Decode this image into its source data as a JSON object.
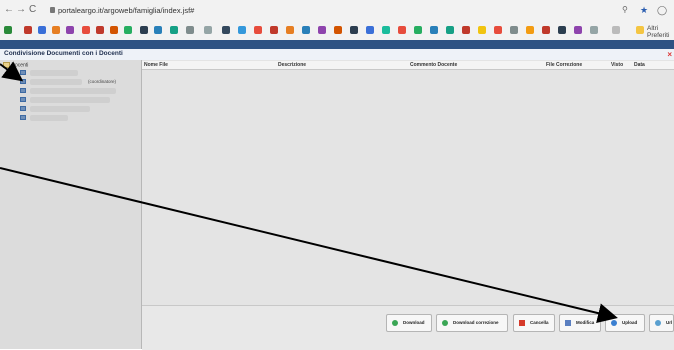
{
  "browser": {
    "url": "portaleargo.it/argoweb/famiglia/index.jsf#",
    "bookmarks_other": "Altri Preferiti"
  },
  "app": {
    "title": "Condivisione Documenti con i Docenti",
    "close_label": "×"
  },
  "tree": {
    "root_label": "Docenti",
    "coordinator_label": "(coordinatore)"
  },
  "table": {
    "columns": [
      "Nome File",
      "Descrizione",
      "Commento Docente",
      "File Correzione",
      "Visto",
      "Data"
    ]
  },
  "buttons": {
    "download": "Download",
    "download_correction": "Download correzione",
    "delete": "Cancella",
    "modify": "Modifica",
    "upload": "Upload",
    "url": "Url"
  }
}
